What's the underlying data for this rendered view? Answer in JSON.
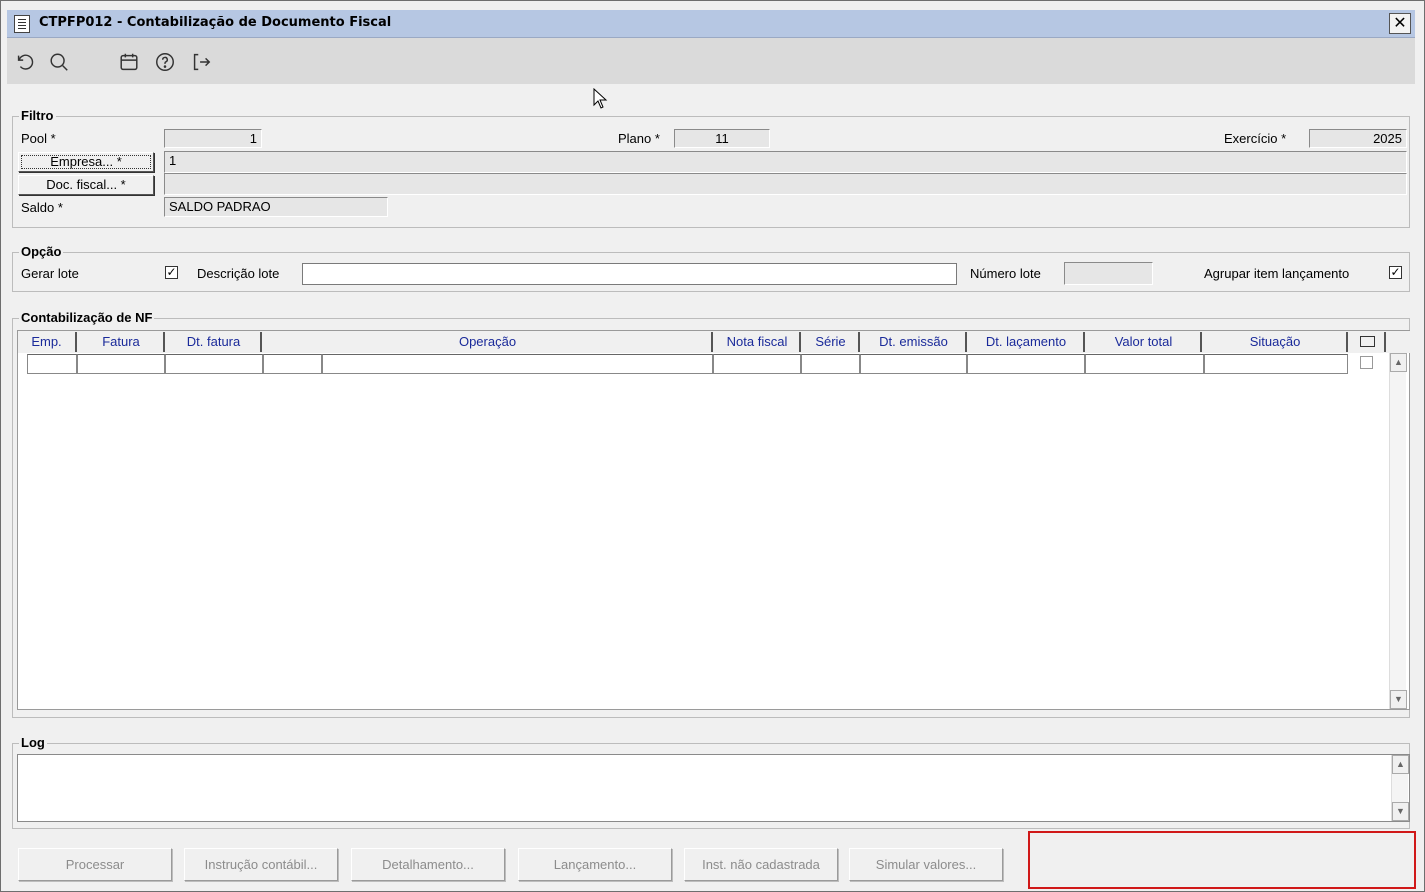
{
  "window": {
    "title": "CTPFP012 - Contabilização de Documento Fiscal",
    "close_glyph": "✕"
  },
  "toolbar": {
    "icons": [
      "undo-icon",
      "search-icon",
      "calendar-icon",
      "help-icon",
      "exit-icon"
    ]
  },
  "filtro": {
    "legend": "Filtro",
    "pool_label": "Pool *",
    "pool_value": "1",
    "plano_label": "Plano *",
    "plano_value": "11",
    "exercicio_label": "Exercício *",
    "exercicio_value": "2025",
    "empresa_button": "Empresa... *",
    "empresa_value": "1",
    "doc_fiscal_button": "Doc. fiscal... *",
    "doc_fiscal_value": "",
    "saldo_label": "Saldo *",
    "saldo_value": "SALDO PADRAO"
  },
  "opcao": {
    "legend": "Opção",
    "gerar_lote_label": "Gerar lote",
    "gerar_lote_checked": "✓",
    "descricao_lote_label": "Descrição lote",
    "descricao_lote_value": "",
    "numero_lote_label": "Número lote",
    "numero_lote_value": "",
    "agrupar_label": "Agrupar item lançamento",
    "agrupar_checked": "✓"
  },
  "grid": {
    "legend": "Contabilização de NF",
    "columns": [
      "Emp.",
      "Fatura",
      "Dt. fatura",
      "Operação",
      "Nota fiscal",
      "Série",
      "Dt. emissão",
      "Dt. laçamento",
      "Valor total",
      "Situação"
    ],
    "scroll_up": "▲",
    "scroll_down": "▼"
  },
  "log": {
    "legend": "Log",
    "value": ""
  },
  "actions": {
    "processar": "Processar",
    "instrucao": "Instrução contábil...",
    "detalhamento": "Detalhamento...",
    "lancamento": "Lançamento...",
    "inst_nao_cadastrada": "Inst. não cadastrada",
    "simular": "Simular valores..."
  },
  "colors": {
    "title_bar": "#b6c7e3",
    "column_header_text": "#1a2a9a",
    "highlight_border": "#d01818"
  }
}
